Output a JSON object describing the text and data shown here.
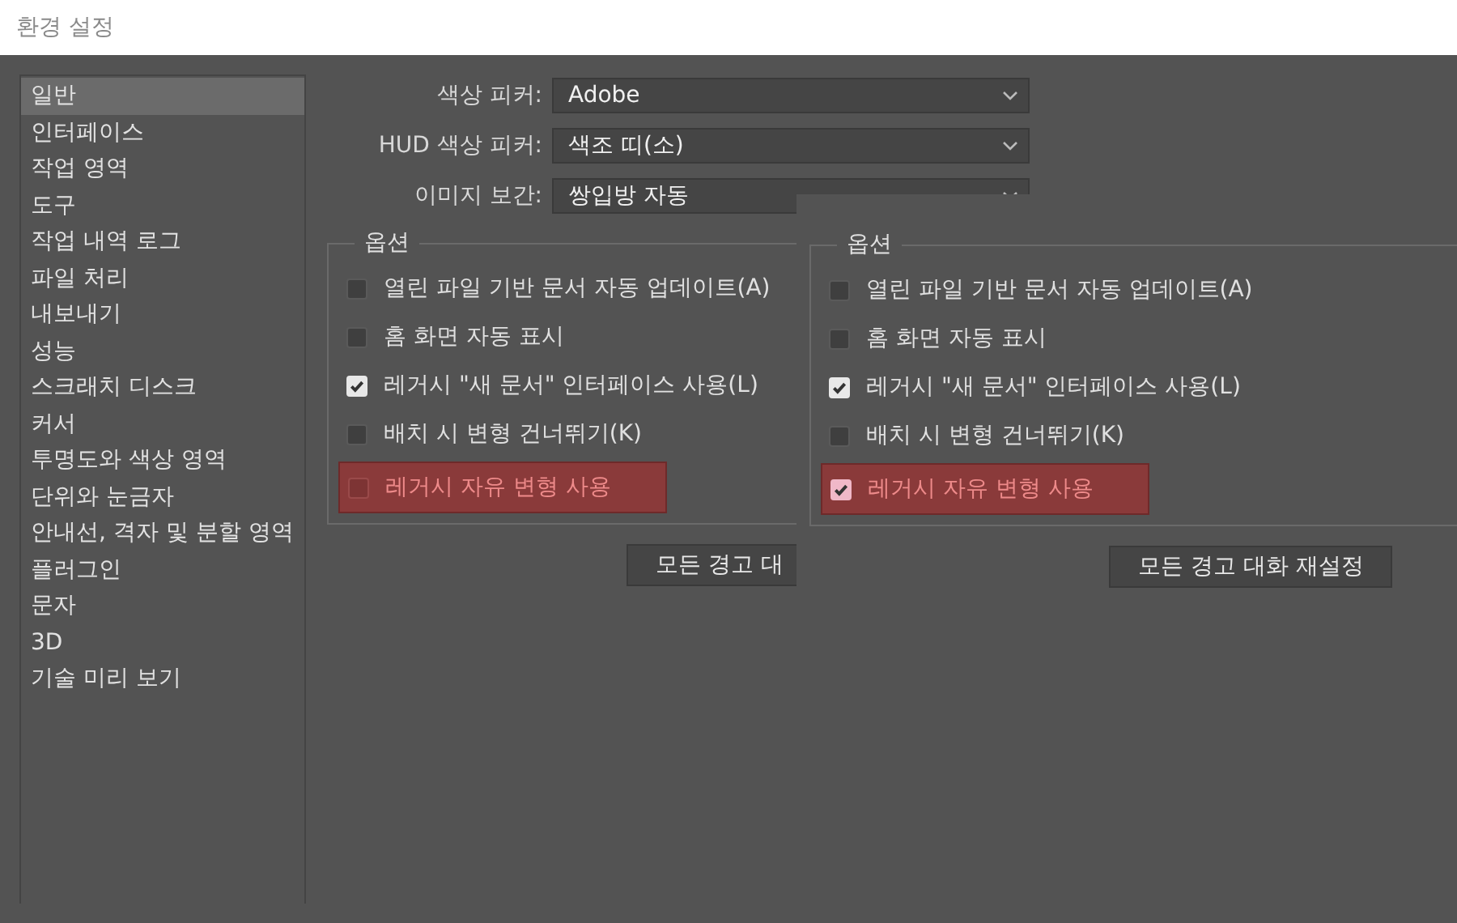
{
  "window": {
    "title": "환경 설정"
  },
  "sidebar": {
    "items": [
      {
        "label": "일반",
        "selected": true
      },
      {
        "label": "인터페이스",
        "selected": false
      },
      {
        "label": "작업 영역",
        "selected": false
      },
      {
        "label": "도구",
        "selected": false
      },
      {
        "label": "작업 내역 로그",
        "selected": false
      },
      {
        "label": "파일 처리",
        "selected": false
      },
      {
        "label": "내보내기",
        "selected": false
      },
      {
        "label": "성능",
        "selected": false
      },
      {
        "label": "스크래치 디스크",
        "selected": false
      },
      {
        "label": "커서",
        "selected": false
      },
      {
        "label": "투명도와 색상 영역",
        "selected": false
      },
      {
        "label": "단위와 눈금자",
        "selected": false
      },
      {
        "label": "안내선, 격자 및 분할 영역",
        "selected": false
      },
      {
        "label": "플러그인",
        "selected": false
      },
      {
        "label": "문자",
        "selected": false
      },
      {
        "label": "3D",
        "selected": false
      },
      {
        "label": "기술 미리 보기",
        "selected": false
      }
    ]
  },
  "panels": [
    {
      "fields": [
        {
          "label": "색상 피커:",
          "value": "Adobe"
        },
        {
          "label": "HUD 색상 피커:",
          "value": "색조 띠(소)"
        },
        {
          "label": "이미지 보간:",
          "value": "쌍입방 자동"
        }
      ],
      "options_title": "옵션",
      "options": [
        {
          "label": "열린 파일 기반 문서 자동 업데이트(A)",
          "checked": false,
          "highlighted": false
        },
        {
          "label": "홈 화면 자동 표시",
          "checked": false,
          "highlighted": false
        },
        {
          "label": "레거시 \"새 문서\" 인터페이스 사용(L)",
          "checked": true,
          "highlighted": false
        },
        {
          "label": "배치 시 변형 건너뛰기(K)",
          "checked": false,
          "highlighted": false
        },
        {
          "label": "레거시 자유 변형 사용",
          "checked": false,
          "highlighted": true
        }
      ],
      "button": "모든 경고 대"
    },
    {
      "options_title": "옵션",
      "options": [
        {
          "label": "열린 파일 기반 문서 자동 업데이트(A)",
          "checked": false,
          "highlighted": false
        },
        {
          "label": "홈 화면 자동 표시",
          "checked": false,
          "highlighted": false
        },
        {
          "label": "레거시 \"새 문서\" 인터페이스 사용(L)",
          "checked": true,
          "highlighted": false
        },
        {
          "label": "배치 시 변형 건너뛰기(K)",
          "checked": false,
          "highlighted": false
        },
        {
          "label": "레거시 자유 변형 사용",
          "checked": true,
          "highlighted": true
        }
      ],
      "button": "모든 경고 대화 재설정"
    }
  ]
}
